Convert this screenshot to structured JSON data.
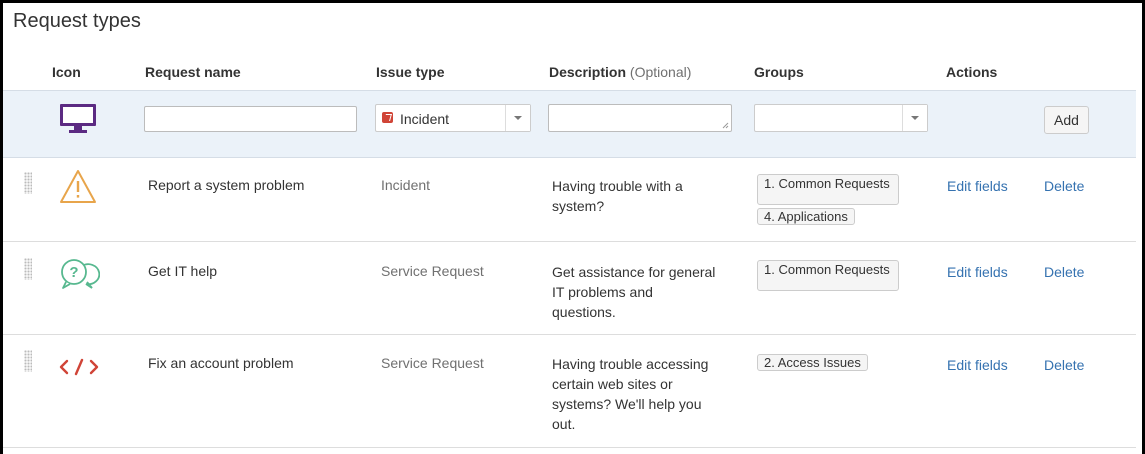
{
  "page": {
    "title": "Request types"
  },
  "headers": {
    "icon": "Icon",
    "request_name": "Request name",
    "issue_type": "Issue type",
    "description": "Description",
    "description_optional": "(Optional)",
    "groups": "Groups",
    "actions": "Actions"
  },
  "add_form": {
    "icon": "monitor-icon",
    "request_name_value": "",
    "issue_type_selected": "Incident",
    "description_value": "",
    "groups_selected": "",
    "add_label": "Add"
  },
  "rows": [
    {
      "icon": "warning-icon",
      "name": "Report a system problem",
      "issue_type": "Incident",
      "description_lines": [
        "Having trouble with a",
        "system?"
      ],
      "groups": [
        "1. Common Requests",
        "4. Applications"
      ],
      "edit_label": "Edit fields",
      "delete_label": "Delete"
    },
    {
      "icon": "question-chat-icon",
      "name": "Get IT help",
      "issue_type": "Service Request",
      "description_lines": [
        "Get assistance for general",
        "IT problems and",
        "questions."
      ],
      "groups": [
        "1. Common Requests"
      ],
      "edit_label": "Edit fields",
      "delete_label": "Delete"
    },
    {
      "icon": "code-icon",
      "name": "Fix an account problem",
      "issue_type": "Service Request",
      "description_lines": [
        "Having trouble accessing",
        "certain web sites or",
        "systems? We'll help you",
        "out."
      ],
      "groups": [
        "2. Access Issues"
      ],
      "edit_label": "Edit fields",
      "delete_label": "Delete"
    }
  ],
  "colors": {
    "link": "#3572b0",
    "add_row_bg": "#ebf2f9",
    "monitor": "#5b2a82",
    "warning": "#e8a54b",
    "chat": "#57b88f",
    "code": "#d04437"
  }
}
